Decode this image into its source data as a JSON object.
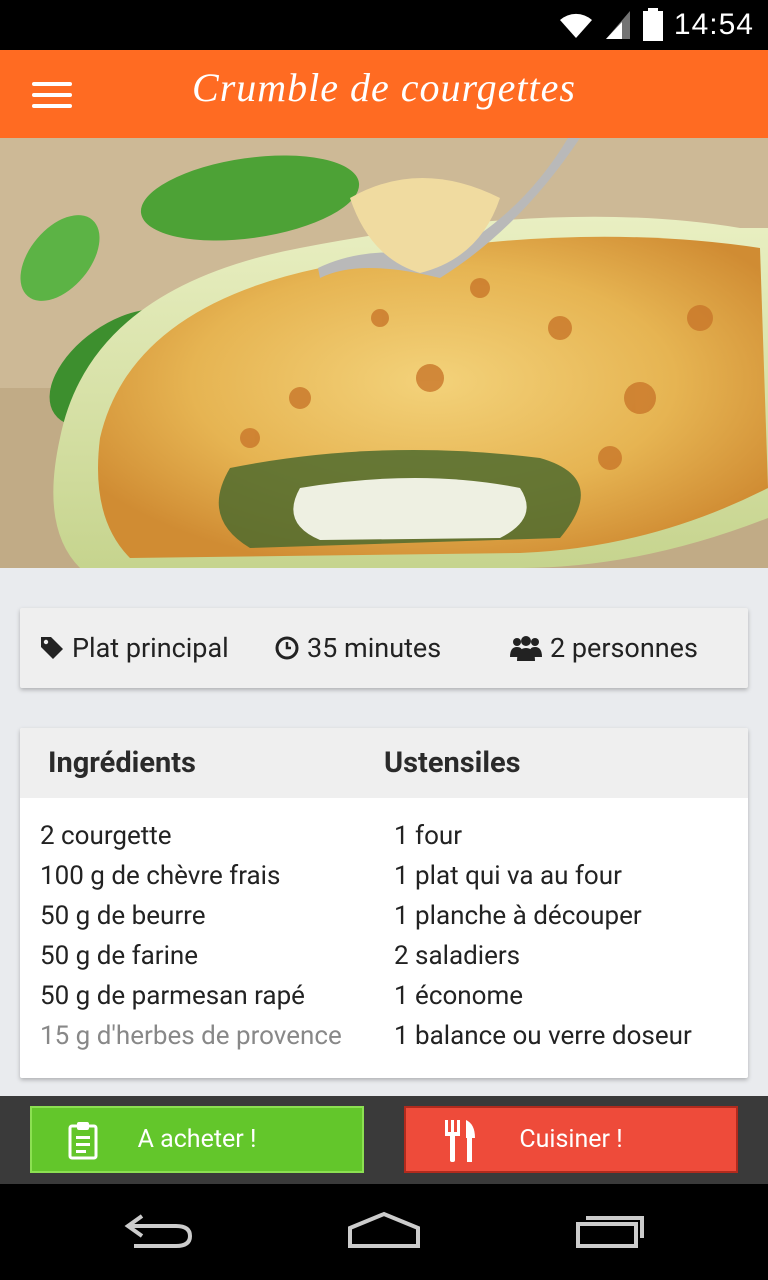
{
  "status_bar": {
    "time": "14:54",
    "icons": [
      "wifi-icon",
      "signal-icon",
      "battery-icon"
    ]
  },
  "toolbar": {
    "menu_icon": "menu-icon",
    "title": "Crumble de courgettes"
  },
  "info": {
    "category": "Plat principal",
    "duration": "35 minutes",
    "servings": "2 personnes",
    "icons": [
      "tag-icon",
      "clock-icon",
      "people-icon"
    ]
  },
  "ingredients": {
    "title": "Ingrédients",
    "items": [
      "2 courgette",
      "100 g de chèvre frais",
      "50 g de beurre",
      "50 g de farine",
      "50 g de parmesan rapé",
      "15 g d'herbes de provence"
    ]
  },
  "utensils": {
    "title": "Ustensiles",
    "items": [
      "1 four",
      "1 plat qui va au four",
      "1 planche à découper",
      "2 saladiers",
      "1 économe",
      "1 balance ou verre doseur"
    ]
  },
  "actions": {
    "buy_label": "A acheter !",
    "cook_label": "Cuisiner !"
  },
  "colors": {
    "toolbar": "#ff6b22",
    "buy": "#63c62b",
    "cook": "#ee4b3a"
  },
  "navbar": [
    "back-icon",
    "home-icon",
    "recents-icon"
  ]
}
